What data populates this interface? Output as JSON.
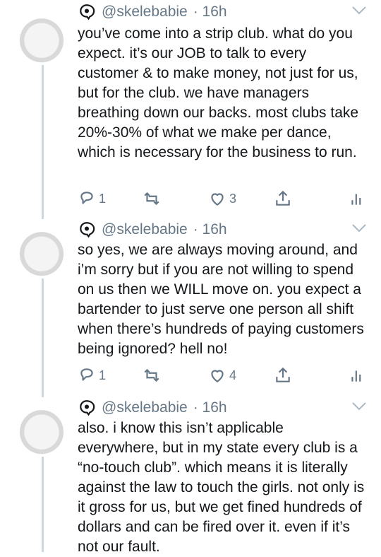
{
  "colors": {
    "text": "#14171a",
    "muted": "#657786",
    "thread_line": "#ccd6dd"
  },
  "tweets": [
    {
      "handle": "@skelebabie",
      "time": "· 16h",
      "text": "you’ve come into a strip club. what do you expect. it’s our JOB to talk to every customer & to make money, not just for us, but for the club. we have managers breathing down our backs. most clubs take 20%-30% of what we make per dance, which is necessary for the business to run.",
      "replies": "1",
      "retweets": "",
      "likes": "3"
    },
    {
      "handle": "@skelebabie",
      "time": "· 16h",
      "text": "so yes, we are always moving around, and i’m sorry but if you are not willing to spend on us then we WILL move on. you expect a bartender to just serve one person all shift when there’s hundreds of paying customers being ignored? hell no!",
      "replies": "1",
      "retweets": "",
      "likes": "4"
    },
    {
      "handle": "@skelebabie",
      "time": "· 16h",
      "text": "also. i know this isn’t applicable everywhere, but in my state every club is a “no-touch club”. which means it is literally against the law to touch the girls. not only is it gross for us, but we get fined hundreds of dollars and can be fired over it. even if it’s not our fault."
    }
  ],
  "icons": {
    "reply": "reply-icon",
    "retweet": "retweet-icon",
    "like": "heart-icon",
    "share": "share-icon",
    "analytics": "analytics-icon",
    "chevron": "chevron-down-icon",
    "indicator": "reply-indicator-icon"
  }
}
